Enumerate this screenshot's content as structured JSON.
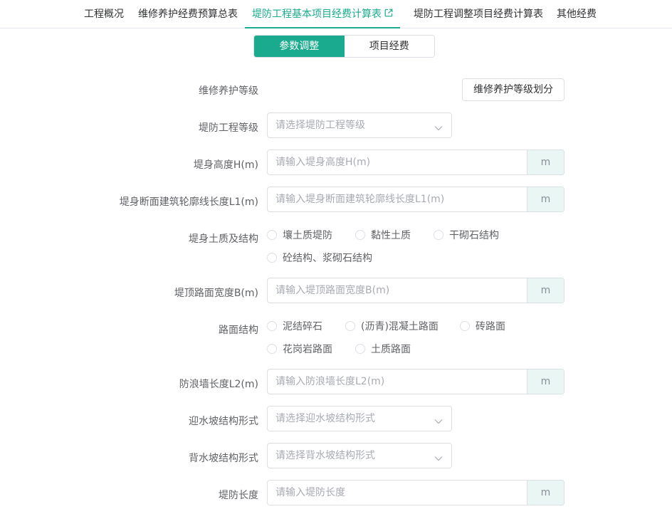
{
  "nav": {
    "tabs": [
      {
        "label": "工程概况"
      },
      {
        "label": "维修养护经费预算总表"
      },
      {
        "label": "堤防工程基本项目经费计算表"
      },
      {
        "label": "堤防工程调整项目经费计算表"
      },
      {
        "label": "其他经费"
      }
    ],
    "active_color": "#1aaa8d"
  },
  "segment": {
    "options": [
      "参数调整",
      "项目经费"
    ],
    "selected": "参数调整"
  },
  "form": {
    "grade": {
      "label": "维修养护等级",
      "button_label": "维修养护等级划分"
    },
    "dike_grade": {
      "label": "堤防工程等级",
      "placeholder": "请选择堤防工程等级"
    },
    "height": {
      "label": "堤身高度H(m)",
      "placeholder": "请输入堤身高度H(m)",
      "unit": "m"
    },
    "contour": {
      "label": "堤身断面建筑轮廓线长度L1(m)",
      "placeholder": "请输入堤身断面建筑轮廓线长度L1(m)",
      "unit": "m"
    },
    "soil": {
      "label": "堤身土质及结构",
      "options": [
        "壤土质堤防",
        "黏性土质",
        "干砌石结构",
        "砼结构、浆砌石结构"
      ]
    },
    "crest_width": {
      "label": "堤顶路面宽度B(m)",
      "placeholder": "请输入堤顶路面宽度B(m)",
      "unit": "m"
    },
    "road": {
      "label": "路面结构",
      "options": [
        "泥结碎石",
        "(沥青)混凝土路面",
        "砖路面",
        "花岗岩路面",
        "土质路面"
      ]
    },
    "wave_wall": {
      "label": "防浪墙长度L2(m)",
      "placeholder": "请输入防浪墙长度L2(m)",
      "unit": "m"
    },
    "upstream_slope": {
      "label": "迎水坡结构形式",
      "placeholder": "请选择迎水坡结构形式"
    },
    "downstream_slope": {
      "label": "背水坡结构形式",
      "placeholder": "请选择背水坡结构形式"
    },
    "dike_length": {
      "label": "堤防长度",
      "placeholder": "请输入堤防长度",
      "unit": "m"
    }
  }
}
